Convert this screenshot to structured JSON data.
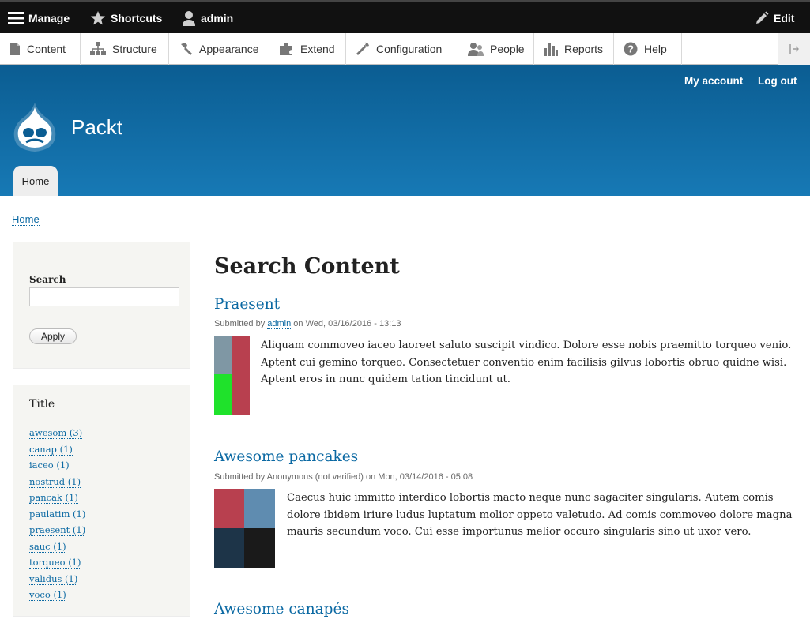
{
  "toolbar": {
    "manage": "Manage",
    "shortcuts": "Shortcuts",
    "user": "admin",
    "edit": "Edit"
  },
  "admin_menu": {
    "items": [
      "Content",
      "Structure",
      "Appearance",
      "Extend",
      "Configuration",
      "People",
      "Reports",
      "Help"
    ]
  },
  "header": {
    "my_account": "My account",
    "log_out": "Log out",
    "site_name": "Packt",
    "home_tab": "Home"
  },
  "breadcrumb": "Home",
  "sidebar": {
    "search": {
      "label": "Search",
      "value": "",
      "apply": "Apply"
    },
    "title_facet": {
      "heading": "Title",
      "items": [
        "awesom (3)",
        "canap (1)",
        "iaceo (1)",
        "nostrud (1)",
        "pancak (1)",
        "paulatim (1)",
        "praesent (1)",
        "sauc (1)",
        "torqueo (1)",
        "validus (1)",
        "voco (1)"
      ]
    }
  },
  "main": {
    "page_title": "Search Content",
    "results": [
      {
        "title": "Praesent",
        "meta_prefix": "Submitted by ",
        "author": "admin",
        "meta_suffix": " on Wed, 03/16/2016 - 13:13",
        "lines": [
          "Aliquam commoveo iaceo laoreet saluto suscipit vindico. Dolore esse nobis praemitto torqueo venio.",
          "Aptent cui gemino torqueo. Consectetuer conventio enim facilisis gilvus lobortis obruo quidne wisi.",
          "Aptent eros in nunc quidem tation tincidunt ut."
        ]
      },
      {
        "title": "Awesome pancakes",
        "meta": "Submitted by Anonymous (not verified) on Mon, 03/14/2016 - 05:08",
        "lines": [
          "Caecus huic immitto interdico lobortis macto neque nunc sagaciter singularis. Autem comis",
          "dolore ibidem iriure ludus luptatum molior oppeto valetudo. Ad comis commoveo dolore magna",
          "mauris secundum voco. Cui esse importunus melior occuro singularis sino ut uxor vero."
        ]
      },
      {
        "title": "Awesome canapés"
      }
    ]
  },
  "colors": {
    "toolbar_bg": "#111111",
    "header_blue": "#1779b5",
    "link_blue": "#0b69a3",
    "sidebar_bg": "#f5f5f2"
  }
}
